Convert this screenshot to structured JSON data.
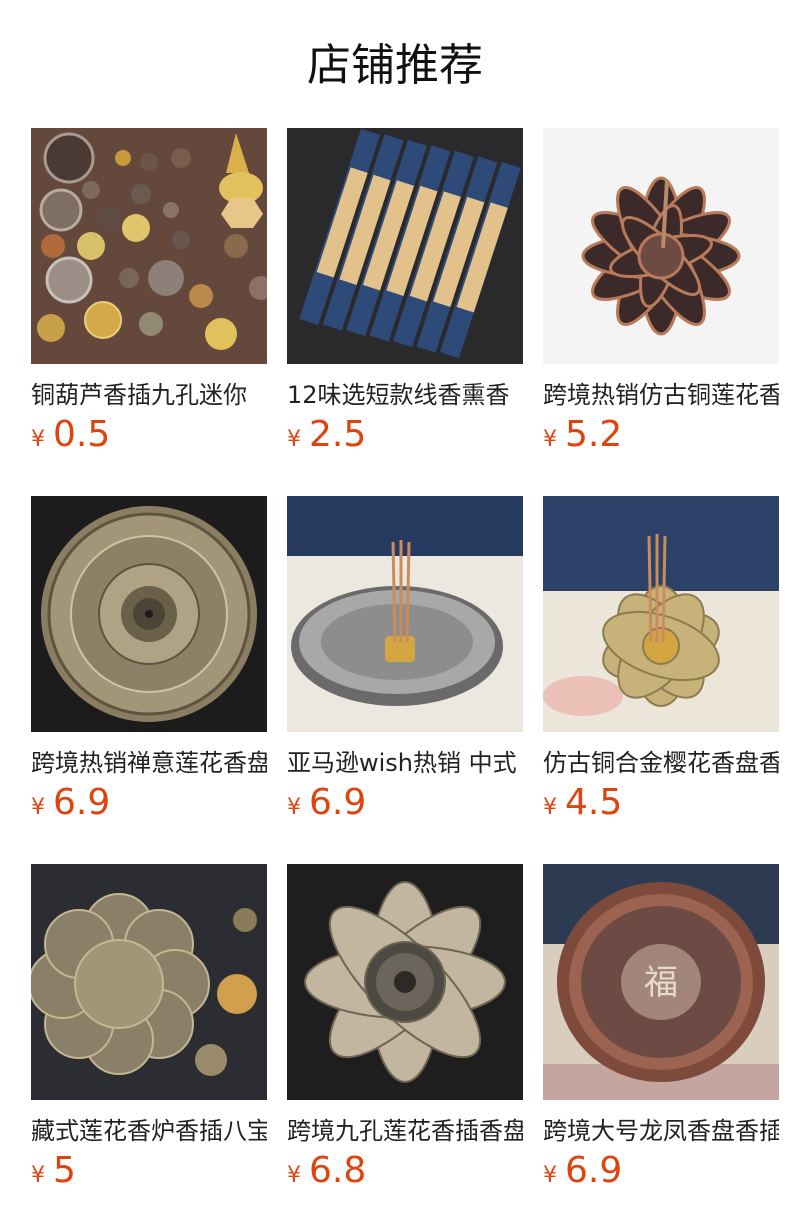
{
  "header": {
    "title": "店铺推荐"
  },
  "colors": {
    "price": "#e0440e",
    "title": "#111111",
    "text": "#222222"
  },
  "products": [
    {
      "name": "铜葫芦香插九孔迷你",
      "currency": "¥",
      "price": "0.5",
      "image": "assorted-brass-incense-holders-image"
    },
    {
      "name": "12味选短款线香熏香",
      "currency": "¥",
      "price": "2.5",
      "image": "incense-tube-boxes-image"
    },
    {
      "name": "跨境热销仿古铜莲花香",
      "currency": "¥",
      "price": "5.2",
      "image": "bronze-lotus-incense-holder-image"
    },
    {
      "name": "跨境热销禅意莲花香盘",
      "currency": "¥",
      "price": "6.9",
      "image": "engraved-brass-plate-image"
    },
    {
      "name": "亚马逊wish热销 中式",
      "currency": "¥",
      "price": "6.9",
      "image": "dragon-plate-incense-holder-image"
    },
    {
      "name": "仿古铜合金樱花香盘香",
      "currency": "¥",
      "price": "4.5",
      "image": "brass-flower-plate-image"
    },
    {
      "name": "藏式莲花香炉香插八宝",
      "currency": "¥",
      "price": "5",
      "image": "tibetan-lotus-plate-set-image"
    },
    {
      "name": "跨境九孔莲花香插香盘",
      "currency": "¥",
      "price": "6.8",
      "image": "silver-lotus-plate-image"
    },
    {
      "name": "跨境大号龙凤香盘香插",
      "currency": "¥",
      "price": "6.9",
      "image": "copper-fu-dragon-plate-image"
    }
  ]
}
